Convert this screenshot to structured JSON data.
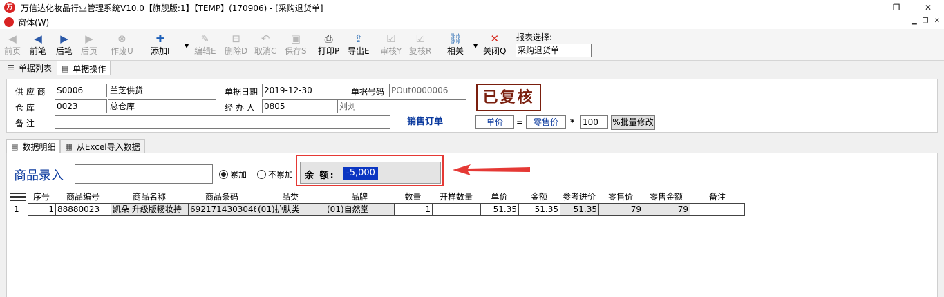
{
  "window": {
    "title": "万信达化妆品行业管理系统V10.0【旗舰版:1】【TEMP】(170906) - [采购退货单]",
    "logo_text": "万",
    "minimize": "—",
    "maximize": "❐",
    "close": "✕"
  },
  "menu": {
    "item": "窗体(W)"
  },
  "toolbar": {
    "buttons": [
      {
        "label": "前页",
        "icon": "first-icon",
        "glyph": "◀",
        "enabled": false
      },
      {
        "label": "前笔",
        "icon": "prev-icon",
        "glyph": "◀",
        "enabled": true
      },
      {
        "label": "后笔",
        "icon": "next-icon",
        "glyph": "▶",
        "enabled": true
      },
      {
        "label": "后页",
        "icon": "last-icon",
        "glyph": "▶",
        "enabled": false
      },
      {
        "label": "作废U",
        "icon": "void-icon",
        "glyph": "⊗",
        "enabled": false
      },
      {
        "label": "添加I",
        "icon": "add-icon",
        "glyph": "✚",
        "enabled": true
      },
      {
        "label": "编辑E",
        "icon": "edit-icon",
        "glyph": "✎",
        "enabled": false
      },
      {
        "label": "删除D",
        "icon": "delete-icon",
        "glyph": "⊟",
        "enabled": false
      },
      {
        "label": "取消C",
        "icon": "cancel-icon",
        "glyph": "↶",
        "enabled": false
      },
      {
        "label": "保存S",
        "icon": "save-icon",
        "glyph": "▣",
        "enabled": false
      },
      {
        "label": "打印P",
        "icon": "print-icon",
        "glyph": "⎙",
        "enabled": true
      },
      {
        "label": "导出E",
        "icon": "export-icon",
        "glyph": "⇪",
        "enabled": true
      },
      {
        "label": "审核Y",
        "icon": "audit-icon",
        "glyph": "☑",
        "enabled": false
      },
      {
        "label": "复核R",
        "icon": "recheck-icon",
        "glyph": "☑",
        "enabled": false
      },
      {
        "label": "相关",
        "icon": "link-icon",
        "glyph": "⛓",
        "enabled": true
      },
      {
        "label": "关闭Q",
        "icon": "close-icon",
        "glyph": "✕",
        "enabled": true
      }
    ],
    "dropdown_glyph": "▼",
    "report_label": "报表选择:",
    "report_value": "采购退货单"
  },
  "tabs_top": [
    {
      "label": "单据列表",
      "icon": "list-icon",
      "glyph": "☰"
    },
    {
      "label": "单据操作",
      "icon": "form-icon",
      "glyph": "▤"
    }
  ],
  "header": {
    "supplier_label": "供 应 商",
    "supplier_code": "S0006",
    "supplier_name": "兰芝供货",
    "date_label": "单据日期",
    "date_value": "2019-12-30",
    "docno_label": "单据号码",
    "docno_value": "POut0000006",
    "warehouse_label": "仓    库",
    "warehouse_code": "0023",
    "warehouse_name": "总仓库",
    "handler_label": "经 办 人",
    "handler_code": "0805",
    "handler_name": "刘刘",
    "remark_label": "备    注",
    "remark_value": "",
    "status_stamp": "已复核",
    "sales_order": "销售订单",
    "price_label": "单价",
    "equals": "=",
    "retail_label": "零售价",
    "multiply": "*",
    "rate_value": "100",
    "batch_button": "%批量修改"
  },
  "tabs_detail": [
    {
      "label": "数据明细",
      "icon": "detail-icon",
      "glyph": "▤"
    },
    {
      "label": "从Excel导入数据",
      "icon": "excel-icon",
      "glyph": "▦"
    }
  ],
  "detail": {
    "goods_label": "商品录入",
    "goods_input": "",
    "radio_accumulate": "累加",
    "radio_no_accumulate": "不累加",
    "balance_label": "余 额:",
    "balance_value": "-5,000",
    "accent_red": "#e53935",
    "accent_blue": "#0b3a9e"
  },
  "table": {
    "columns": [
      "序号",
      "商品编号",
      "商品名称",
      "商品条码",
      "品类",
      "品牌",
      "数量",
      "开样数量",
      "单价",
      "金额",
      "参考进价",
      "零售价",
      "零售金额",
      "备注"
    ],
    "rows": [
      {
        "rownum": "1",
        "cells": [
          "1",
          "88880023",
          "凯朵 升级版畅妆持",
          "6921714303048",
          "(01)护肤类",
          "(01)自然堂",
          "1",
          "",
          "51.35",
          "51.35",
          "51.35",
          "79",
          "79",
          ""
        ]
      }
    ]
  }
}
